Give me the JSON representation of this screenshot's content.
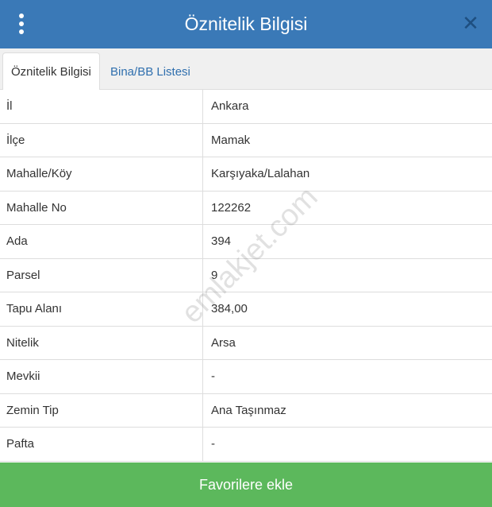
{
  "header": {
    "title": "Öznitelik Bilgisi",
    "menu_icon": "more-vertical-icon",
    "close_icon": "close-icon",
    "color": "#3a79b7"
  },
  "tabs": [
    {
      "label": "Öznitelik Bilgisi",
      "active": true
    },
    {
      "label": "Bina/BB Listesi",
      "active": false
    }
  ],
  "attributes": [
    {
      "key": "İl",
      "value": "Ankara"
    },
    {
      "key": "İlçe",
      "value": "Mamak"
    },
    {
      "key": "Mahalle/Köy",
      "value": "Karşıyaka/Lalahan"
    },
    {
      "key": "Mahalle No",
      "value": "122262"
    },
    {
      "key": "Ada",
      "value": "394"
    },
    {
      "key": "Parsel",
      "value": "9"
    },
    {
      "key": "Tapu Alanı",
      "value": "384,00"
    },
    {
      "key": "Nitelik",
      "value": "Arsa"
    },
    {
      "key": "Mevkii",
      "value": "-"
    },
    {
      "key": "Zemin Tip",
      "value": "Ana Taşınmaz"
    },
    {
      "key": "Pafta",
      "value": "-"
    }
  ],
  "watermark": "emlakjet.com",
  "footer": {
    "button_label": "Favorilere ekle",
    "color": "#5cb85c"
  }
}
